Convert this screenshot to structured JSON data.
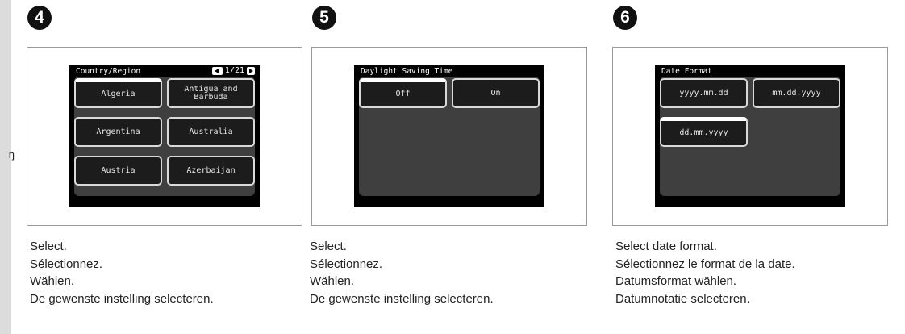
{
  "steps": [
    {
      "number": "4",
      "screen": {
        "title": "Country/Region",
        "page_indicator": "1/21",
        "buttons": [
          "Algeria",
          "Antigua and Barbuda",
          "Argentina",
          "Australia",
          "Austria",
          "Azerbaijan"
        ]
      },
      "caption": [
        "Select.",
        "Sélectionnez.",
        "Wählen.",
        "De gewenste instelling selecteren."
      ]
    },
    {
      "number": "5",
      "screen": {
        "title": "Daylight Saving Time",
        "buttons": [
          "Off",
          "On"
        ]
      },
      "caption": [
        "Select.",
        "Sélectionnez.",
        "Wählen.",
        "De gewenste instelling selecteren."
      ]
    },
    {
      "number": "6",
      "screen": {
        "title": "Date Format",
        "buttons": [
          "yyyy.mm.dd",
          "mm.dd.yyyy",
          "dd.mm.yyyy"
        ]
      },
      "caption": [
        "Select date format.",
        "Sélectionnez le format de la date.",
        "Datumsformat wählen.",
        "Datumnotatie selecteren."
      ]
    }
  ]
}
